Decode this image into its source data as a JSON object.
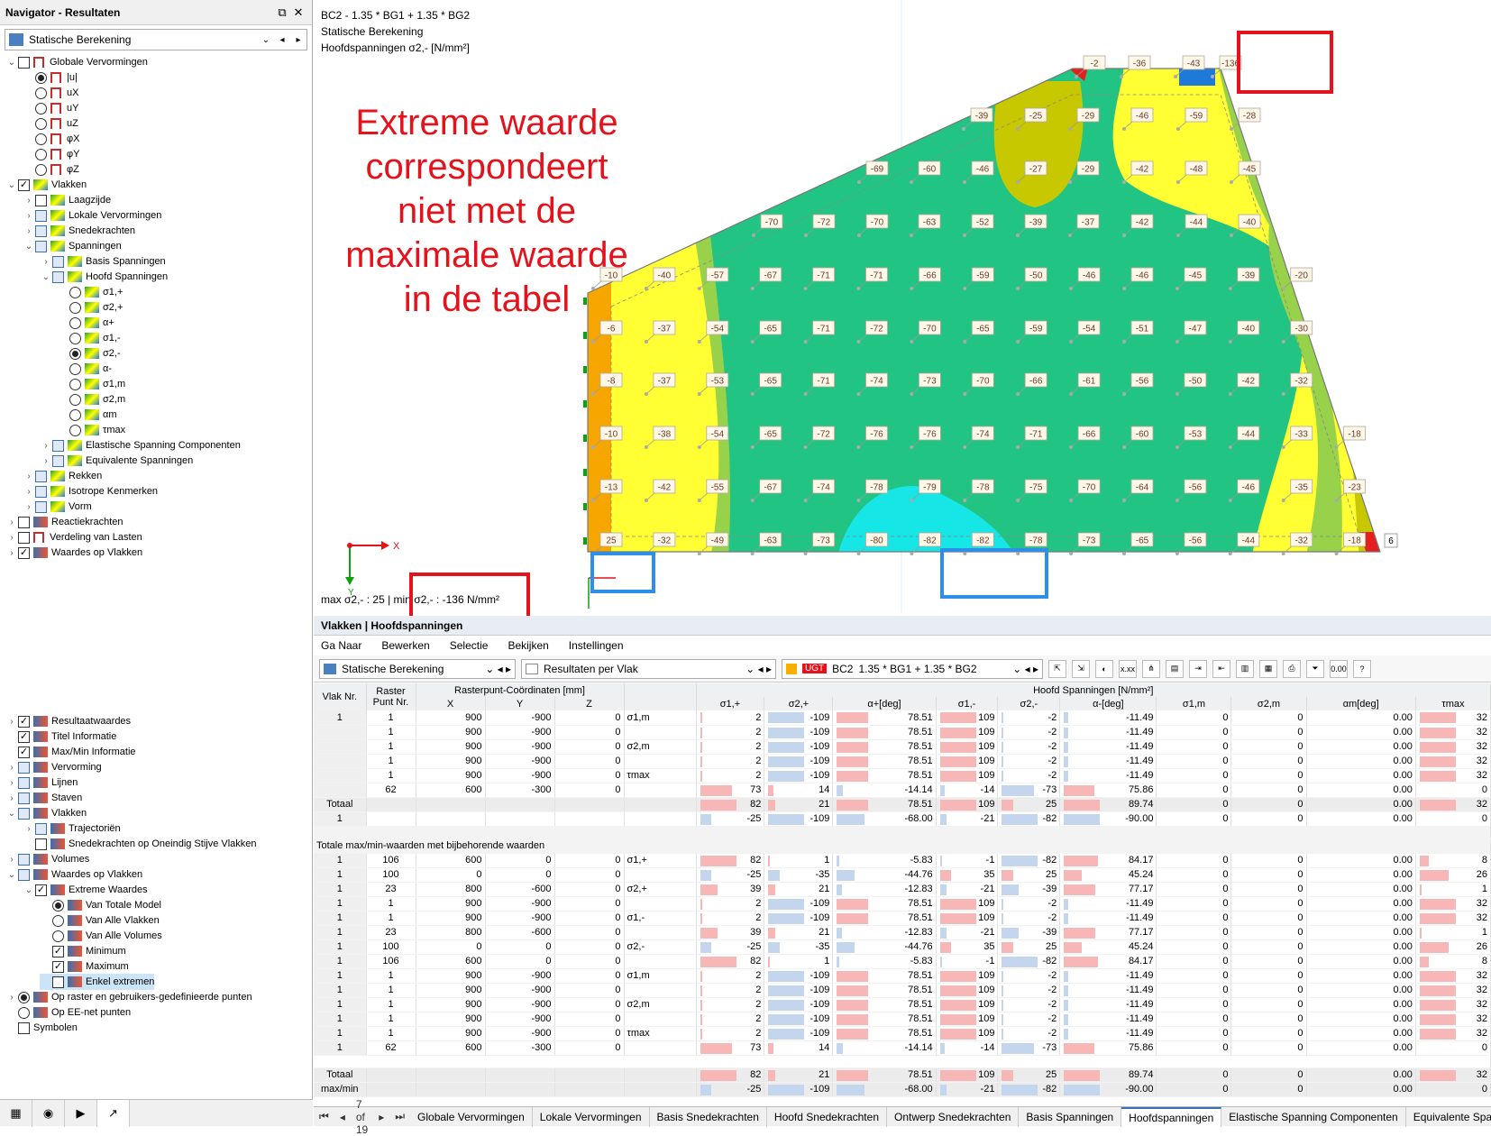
{
  "navigator": {
    "title": "Navigator - Resultaten",
    "combo": "Statische Berekening",
    "top": [
      {
        "t": "Globale Vervormingen",
        "lv": 0,
        "type": "cb",
        "on": false,
        "ic": "dm",
        "tg": "v"
      },
      {
        "t": "|u|",
        "lv": 1,
        "type": "rb",
        "on": true,
        "ic": "dm"
      },
      {
        "t": "uX",
        "lv": 1,
        "type": "rb",
        "on": false,
        "ic": "dm"
      },
      {
        "t": "uY",
        "lv": 1,
        "type": "rb",
        "on": false,
        "ic": "dm"
      },
      {
        "t": "uZ",
        "lv": 1,
        "type": "rb",
        "on": false,
        "ic": "dm"
      },
      {
        "t": "φX",
        "lv": 1,
        "type": "rb",
        "on": false,
        "ic": "dm"
      },
      {
        "t": "φY",
        "lv": 1,
        "type": "rb",
        "on": false,
        "ic": "dm"
      },
      {
        "t": "φZ",
        "lv": 1,
        "type": "rb",
        "on": false,
        "ic": "dm"
      },
      {
        "t": "Vlakken",
        "lv": 0,
        "type": "cb",
        "on": true,
        "ic": "sf",
        "tg": "v"
      },
      {
        "t": "Laagzijde",
        "lv": 1,
        "type": "cb",
        "on": false,
        "ic": "sf",
        "tg": ">"
      },
      {
        "t": "Lokale Vervormingen",
        "lv": 1,
        "type": "cbb",
        "on": false,
        "ic": "sf",
        "tg": ">"
      },
      {
        "t": "Snedekrachten",
        "lv": 1,
        "type": "cbb",
        "on": false,
        "ic": "sf",
        "tg": ">"
      },
      {
        "t": "Spanningen",
        "lv": 1,
        "type": "cbb",
        "on": false,
        "ic": "sf",
        "tg": "v"
      },
      {
        "t": "Basis Spanningen",
        "lv": 2,
        "type": "cbb",
        "on": false,
        "ic": "sf",
        "tg": ">"
      },
      {
        "t": "Hoofd Spanningen",
        "lv": 2,
        "type": "cbb",
        "on": false,
        "ic": "sf",
        "tg": "v"
      },
      {
        "t": "σ1,+",
        "lv": 3,
        "type": "rb",
        "on": false,
        "ic": "sf"
      },
      {
        "t": "σ2,+",
        "lv": 3,
        "type": "rb",
        "on": false,
        "ic": "sf"
      },
      {
        "t": "α+",
        "lv": 3,
        "type": "rb",
        "on": false,
        "ic": "sf"
      },
      {
        "t": "σ1,-",
        "lv": 3,
        "type": "rb",
        "on": false,
        "ic": "sf"
      },
      {
        "t": "σ2,-",
        "lv": 3,
        "type": "rb",
        "on": true,
        "ic": "sf"
      },
      {
        "t": "α-",
        "lv": 3,
        "type": "rb",
        "on": false,
        "ic": "sf"
      },
      {
        "t": "σ1,m",
        "lv": 3,
        "type": "rb",
        "on": false,
        "ic": "sf"
      },
      {
        "t": "σ2,m",
        "lv": 3,
        "type": "rb",
        "on": false,
        "ic": "sf"
      },
      {
        "t": "αm",
        "lv": 3,
        "type": "rb",
        "on": false,
        "ic": "sf"
      },
      {
        "t": "τmax",
        "lv": 3,
        "type": "rb",
        "on": false,
        "ic": "sf"
      },
      {
        "t": "Elastische Spanning Componenten",
        "lv": 2,
        "type": "cbb",
        "on": false,
        "ic": "sf",
        "tg": ">"
      },
      {
        "t": "Equivalente Spanningen",
        "lv": 2,
        "type": "cbb",
        "on": false,
        "ic": "sf",
        "tg": ">"
      },
      {
        "t": "Rekken",
        "lv": 1,
        "type": "cbb",
        "on": false,
        "ic": "sf",
        "tg": ">"
      },
      {
        "t": "Isotrope Kenmerken",
        "lv": 1,
        "type": "cbb",
        "on": false,
        "ic": "sf",
        "tg": ">"
      },
      {
        "t": "Vorm",
        "lv": 1,
        "type": "cbb",
        "on": false,
        "ic": "sf",
        "tg": ">"
      },
      {
        "t": "Reactiekrachten",
        "lv": 0,
        "type": "cb",
        "on": false,
        "ic": "lv",
        "tg": ">"
      },
      {
        "t": "Verdeling van Lasten",
        "lv": 0,
        "type": "cb",
        "on": false,
        "ic": "dm",
        "tg": ">"
      },
      {
        "t": "Waardes op Vlakken",
        "lv": 0,
        "type": "cb",
        "on": true,
        "ic": "lv",
        "tg": ">"
      }
    ],
    "bottom": [
      {
        "t": "Resultaatwaardes",
        "lv": 0,
        "type": "cb",
        "on": true,
        "ic": "lv",
        "tg": ">"
      },
      {
        "t": "Titel Informatie",
        "lv": 0,
        "type": "cb",
        "on": true,
        "ic": "lv",
        "tg": ""
      },
      {
        "t": "Max/Min Informatie",
        "lv": 0,
        "type": "cb",
        "on": true,
        "ic": "lv",
        "tg": ""
      },
      {
        "t": "Vervorming",
        "lv": 0,
        "type": "cbb",
        "on": false,
        "ic": "lv",
        "tg": ">"
      },
      {
        "t": "Lijnen",
        "lv": 0,
        "type": "cbb",
        "on": false,
        "ic": "lv",
        "tg": ">"
      },
      {
        "t": "Staven",
        "lv": 0,
        "type": "cbb",
        "on": false,
        "ic": "lv",
        "tg": ">"
      },
      {
        "t": "Vlakken",
        "lv": 0,
        "type": "cbb",
        "on": false,
        "ic": "lv",
        "tg": "v"
      },
      {
        "t": "Trajectoriën",
        "lv": 1,
        "type": "cbb",
        "on": false,
        "ic": "lv",
        "tg": ">"
      },
      {
        "t": "Snedekrachten op Oneindig Stijve Vlakken",
        "lv": 1,
        "type": "cb",
        "on": false,
        "ic": "lv",
        "tg": ""
      },
      {
        "t": "Volumes",
        "lv": 0,
        "type": "cbb",
        "on": false,
        "ic": "lv",
        "tg": ">"
      },
      {
        "t": "Waardes op Vlakken",
        "lv": 0,
        "type": "cbb",
        "on": false,
        "ic": "lv",
        "tg": "v"
      },
      {
        "t": "Extreme Waardes",
        "lv": 1,
        "type": "cb",
        "on": true,
        "ic": "lv",
        "tg": "v"
      },
      {
        "t": "Van Totale Model",
        "lv": 2,
        "type": "rb",
        "on": true,
        "ic": "lv"
      },
      {
        "t": "Van Alle Vlakken",
        "lv": 2,
        "type": "rb",
        "on": false,
        "ic": "lv"
      },
      {
        "t": "Van Alle Volumes",
        "lv": 2,
        "type": "rb",
        "on": false,
        "ic": "lv"
      },
      {
        "t": "Minimum",
        "lv": 2,
        "type": "cb",
        "on": true,
        "ic": "lv"
      },
      {
        "t": "Maximum",
        "lv": 2,
        "type": "cb",
        "on": true,
        "ic": "lv"
      },
      {
        "t": "Enkel extremen",
        "lv": 2,
        "type": "cb",
        "on": false,
        "ic": "lv",
        "sel": true
      },
      {
        "t": "Op raster en gebruikers-gedefinieerde punten",
        "lv": 0,
        "type": "rb",
        "on": true,
        "ic": "lv",
        "tg": ">"
      },
      {
        "t": "Op EE-net punten",
        "lv": 0,
        "type": "rb",
        "on": false,
        "ic": "lv",
        "tg": ""
      },
      {
        "t": "Symbolen",
        "lv": 0,
        "type": "cb",
        "on": false,
        "ic": "",
        "tg": ""
      }
    ]
  },
  "view": {
    "line1": "BC2 - 1.35 * BG1 + 1.35 * BG2",
    "line2": "Statische Berekening",
    "line3": "Hoofdspanningen σ2,- [N/mm²]",
    "annotation": "Extreme waarde correspondeert niet met de maximale waarde in de tabel",
    "maxmin": "max σ2,- : 25 | min σ2,- : -136 N/mm²",
    "axis_x": "X",
    "axis_y": "Y",
    "node_label": "6",
    "grid_values": [
      [
        "",
        "",
        "",
        "",
        "",
        "",
        "",
        "",
        "",
        "-2",
        "-36",
        "-43",
        "-136"
      ],
      [
        "",
        "",
        "",
        "",
        "",
        "",
        "",
        "-39",
        "-25",
        "-29",
        "-46",
        "-59",
        "-28"
      ],
      [
        "",
        "",
        "",
        "",
        "",
        "-69",
        "-60",
        "-46",
        "-27",
        "-29",
        "-42",
        "-48",
        "-45"
      ],
      [
        "",
        "",
        "",
        "-70",
        "-72",
        "-70",
        "-63",
        "-52",
        "-39",
        "-37",
        "-42",
        "-44",
        "-40"
      ],
      [
        "-10",
        "-40",
        "-57",
        "-67",
        "-71",
        "-71",
        "-66",
        "-59",
        "-50",
        "-46",
        "-46",
        "-45",
        "-39",
        "-20"
      ],
      [
        "-6",
        "-37",
        "-54",
        "-65",
        "-71",
        "-72",
        "-70",
        "-65",
        "-59",
        "-54",
        "-51",
        "-47",
        "-40",
        "-30"
      ],
      [
        "-8",
        "-37",
        "-53",
        "-65",
        "-71",
        "-74",
        "-73",
        "-70",
        "-66",
        "-61",
        "-56",
        "-50",
        "-42",
        "-32"
      ],
      [
        "-10",
        "-38",
        "-54",
        "-65",
        "-72",
        "-76",
        "-76",
        "-74",
        "-71",
        "-66",
        "-60",
        "-53",
        "-44",
        "-33",
        "-18"
      ],
      [
        "-13",
        "-42",
        "-55",
        "-67",
        "-74",
        "-78",
        "-79",
        "-78",
        "-75",
        "-70",
        "-64",
        "-56",
        "-46",
        "-35",
        "-23"
      ],
      [
        "25",
        "-32",
        "-49",
        "-63",
        "-73",
        "-80",
        "-82",
        "-82",
        "-78",
        "-73",
        "-65",
        "-56",
        "-44",
        "-32",
        "-18"
      ]
    ]
  },
  "table": {
    "title": "Vlakken | Hoofdspanningen",
    "menu": [
      "Ga Naar",
      "Bewerken",
      "Selectie",
      "Bekijken",
      "Instellingen"
    ],
    "combo1": "Statische Berekening",
    "combo2": "Resultaten per Vlak",
    "lc_badge": "UGT",
    "lc_code": "BC2",
    "lc_name": "1.35 * BG1 + 1.35 * BG2",
    "h_vlak": "Vlak Nr.",
    "h_raster": "Raster Punt Nr.",
    "h_coord": "Rasterpunt-Coördinaten [mm]",
    "h_x": "X",
    "h_y": "Y",
    "h_z": "Z",
    "h_hs": "Hoofd Spanningen [N/mm²]",
    "cols": [
      "σ1,+",
      "σ2,+",
      "α+[deg]",
      "σ1,-",
      "σ2,-",
      "α-[deg]",
      "σ1,m",
      "σ2,m",
      "αm[deg]",
      "τmax"
    ],
    "rows1": [
      [
        "1",
        "1",
        "900",
        "-900",
        "0",
        "σ1,m",
        "2",
        "-109",
        "78.51",
        "109",
        "-2",
        "-11.49",
        "0",
        "0",
        "0.00",
        "32"
      ],
      [
        "",
        "1",
        "900",
        "-900",
        "0",
        "",
        "2",
        "-109",
        "78.51",
        "109",
        "-2",
        "-11.49",
        "0",
        "0",
        "0.00",
        "32"
      ],
      [
        "",
        "1",
        "900",
        "-900",
        "0",
        "σ2,m",
        "2",
        "-109",
        "78.51",
        "109",
        "-2",
        "-11.49",
        "0",
        "0",
        "0.00",
        "32"
      ],
      [
        "",
        "1",
        "900",
        "-900",
        "0",
        "",
        "2",
        "-109",
        "78.51",
        "109",
        "-2",
        "-11.49",
        "0",
        "0",
        "0.00",
        "32"
      ],
      [
        "",
        "1",
        "900",
        "-900",
        "0",
        "τmax",
        "2",
        "-109",
        "78.51",
        "109",
        "-2",
        "-11.49",
        "0",
        "0",
        "0.00",
        "32"
      ],
      [
        "",
        "62",
        "600",
        "-300",
        "0",
        "",
        "73",
        "14",
        "-14.14",
        "-14",
        "-73",
        "75.86",
        "0",
        "0",
        "0.00",
        "0"
      ]
    ],
    "tot1": [
      [
        "Totaal",
        "",
        "",
        "",
        "",
        "",
        "82",
        "21",
        "78.51",
        "109",
        "25",
        "89.74",
        "0",
        "0",
        "0.00",
        "32"
      ],
      [
        "1",
        "",
        "",
        "",
        "",
        "",
        "-25",
        "-109",
        "-68.00",
        "-21",
        "-82",
        "-90.00",
        "0",
        "0",
        "0.00",
        "0"
      ]
    ],
    "section": "Totale max/min-waarden met bijbehorende waarden",
    "rows2": [
      [
        "1",
        "106",
        "600",
        "0",
        "0",
        "σ1,+",
        "82",
        "1",
        "-5.83",
        "-1",
        "-82",
        "84.17",
        "0",
        "0",
        "0.00",
        "8"
      ],
      [
        "1",
        "100",
        "0",
        "0",
        "0",
        "",
        "-25",
        "-35",
        "-44.76",
        "35",
        "25",
        "45.24",
        "0",
        "0",
        "0.00",
        "26"
      ],
      [
        "1",
        "23",
        "800",
        "-600",
        "0",
        "σ2,+",
        "39",
        "21",
        "-12.83",
        "-21",
        "-39",
        "77.17",
        "0",
        "0",
        "0.00",
        "1"
      ],
      [
        "1",
        "1",
        "900",
        "-900",
        "0",
        "",
        "2",
        "-109",
        "78.51",
        "109",
        "-2",
        "-11.49",
        "0",
        "0",
        "0.00",
        "32"
      ],
      [
        "1",
        "1",
        "900",
        "-900",
        "0",
        "σ1,-",
        "2",
        "-109",
        "78.51",
        "109",
        "-2",
        "-11.49",
        "0",
        "0",
        "0.00",
        "32"
      ],
      [
        "1",
        "23",
        "800",
        "-600",
        "0",
        "",
        "39",
        "21",
        "-12.83",
        "-21",
        "-39",
        "77.17",
        "0",
        "0",
        "0.00",
        "1"
      ],
      [
        "1",
        "100",
        "0",
        "0",
        "0",
        "σ2,-",
        "-25",
        "-35",
        "-44.76",
        "35",
        "25",
        "45.24",
        "0",
        "0",
        "0.00",
        "26"
      ],
      [
        "1",
        "106",
        "600",
        "0",
        "0",
        "",
        "82",
        "1",
        "-5.83",
        "-1",
        "-82",
        "84.17",
        "0",
        "0",
        "0.00",
        "8"
      ],
      [
        "1",
        "1",
        "900",
        "-900",
        "0",
        "σ1,m",
        "2",
        "-109",
        "78.51",
        "109",
        "-2",
        "-11.49",
        "0",
        "0",
        "0.00",
        "32"
      ],
      [
        "1",
        "1",
        "900",
        "-900",
        "0",
        "",
        "2",
        "-109",
        "78.51",
        "109",
        "-2",
        "-11.49",
        "0",
        "0",
        "0.00",
        "32"
      ],
      [
        "1",
        "1",
        "900",
        "-900",
        "0",
        "σ2,m",
        "2",
        "-109",
        "78.51",
        "109",
        "-2",
        "-11.49",
        "0",
        "0",
        "0.00",
        "32"
      ],
      [
        "1",
        "1",
        "900",
        "-900",
        "0",
        "",
        "2",
        "-109",
        "78.51",
        "109",
        "-2",
        "-11.49",
        "0",
        "0",
        "0.00",
        "32"
      ],
      [
        "1",
        "1",
        "900",
        "-900",
        "0",
        "τmax",
        "2",
        "-109",
        "78.51",
        "109",
        "-2",
        "-11.49",
        "0",
        "0",
        "0.00",
        "32"
      ],
      [
        "1",
        "62",
        "600",
        "-300",
        "0",
        "",
        "73",
        "14",
        "-14.14",
        "-14",
        "-73",
        "75.86",
        "0",
        "0",
        "0.00",
        "0"
      ]
    ],
    "tot2": [
      [
        "Totaal",
        "",
        "",
        "",
        "",
        "",
        "82",
        "21",
        "78.51",
        "109",
        "25",
        "89.74",
        "0",
        "0",
        "0.00",
        "32"
      ],
      [
        "max/min",
        "",
        "",
        "",
        "",
        "",
        "-25",
        "-109",
        "-68.00",
        "-21",
        "-82",
        "-90.00",
        "0",
        "0",
        "0.00",
        "0"
      ]
    ],
    "pager": "7 of 19",
    "tabs": [
      "Globale Vervormingen",
      "Lokale Vervormingen",
      "Basis Snedekrachten",
      "Hoofd Snedekrachten",
      "Ontwerp Snedekrachten",
      "Basis Spanningen",
      "Hoofdspanningen",
      "Elastische Spanning Componenten",
      "Equivalente Spanningen"
    ],
    "active_tab": "Hoofdspanningen"
  },
  "colors": {
    "accent": "#e3121b",
    "highlight": "#2f8ee8",
    "pos_bar": "#f7b7b7",
    "neg_bar": "#c4d5ee"
  }
}
